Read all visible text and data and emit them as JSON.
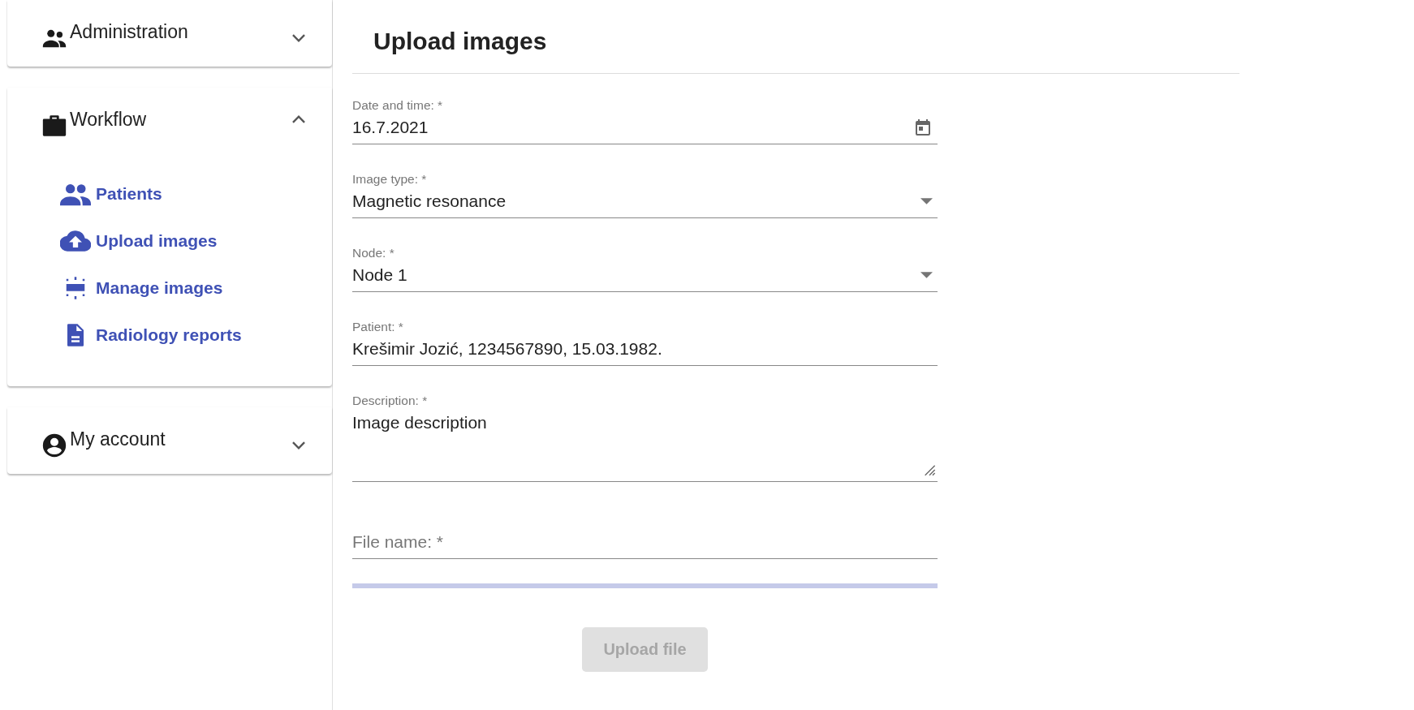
{
  "sidebar": {
    "sections": [
      {
        "title": "Administration",
        "expanded": false
      },
      {
        "title": "Workflow",
        "expanded": true,
        "items": [
          {
            "label": "Patients"
          },
          {
            "label": "Upload images"
          },
          {
            "label": "Manage images"
          },
          {
            "label": "Radiology reports"
          }
        ]
      },
      {
        "title": "My account",
        "expanded": false
      }
    ]
  },
  "page": {
    "title": "Upload images"
  },
  "form": {
    "fields": [
      {
        "kind": "date",
        "label": "Date and time: *",
        "value": "16.7.2021"
      },
      {
        "kind": "select",
        "label": "Image type: *",
        "value": "Magnetic resonance"
      },
      {
        "kind": "select",
        "label": "Node: *",
        "value": "Node 1"
      },
      {
        "kind": "text",
        "label": "Patient: *",
        "value": "Krešimir Jozić, 1234567890, 15.03.1982."
      },
      {
        "kind": "textarea",
        "label": "Description: *",
        "value": "Image description"
      },
      {
        "kind": "file",
        "placeholder": "File name: *"
      }
    ],
    "progress": {
      "level": 0
    },
    "upload_button": {
      "label": "Upload file",
      "disabled": true
    }
  }
}
